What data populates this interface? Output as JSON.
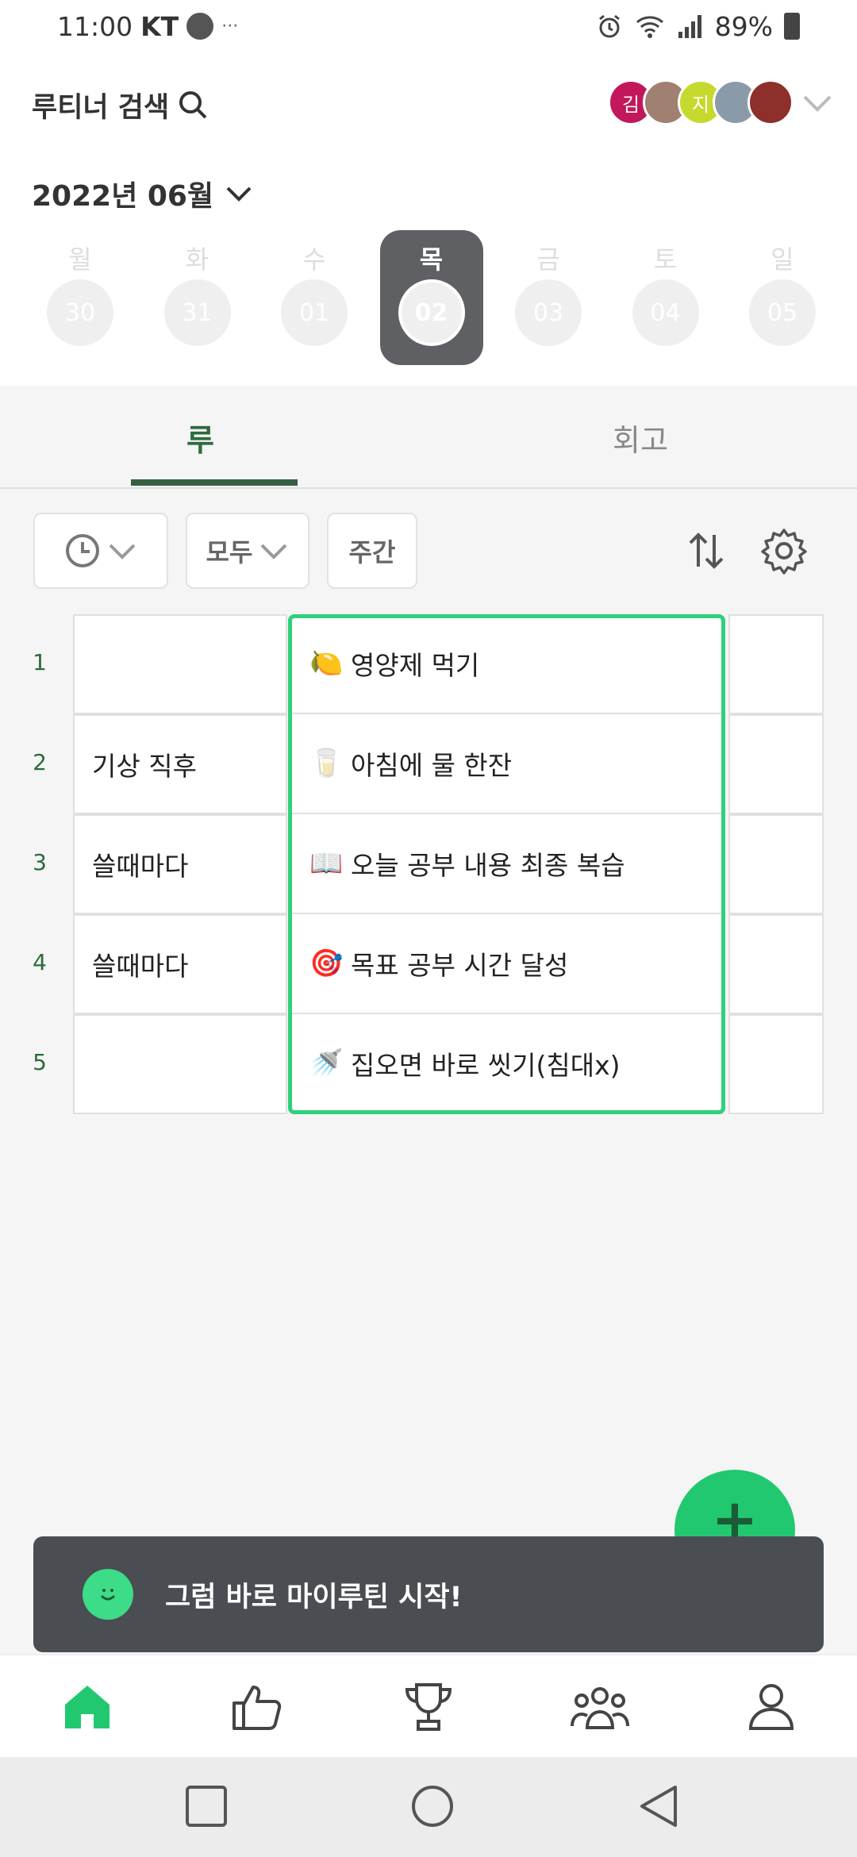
{
  "status_bar": {
    "time": "11:00",
    "carrier": "KT",
    "extra": "···",
    "battery": "89%"
  },
  "header": {
    "search_label": "루티너 검색",
    "avatars": [
      {
        "label": "김",
        "color": "#c2185b"
      },
      {
        "label": "",
        "color": "#a08070"
      },
      {
        "label": "지",
        "color": "#c6d92e"
      },
      {
        "label": "",
        "color": "#8a9aa8"
      },
      {
        "label": "",
        "color": "#8d2f2a"
      }
    ],
    "month": "2022년 06월"
  },
  "week": {
    "days": [
      {
        "dow": "월",
        "num": "30",
        "selected": false
      },
      {
        "dow": "화",
        "num": "31",
        "selected": false
      },
      {
        "dow": "수",
        "num": "01",
        "selected": false
      },
      {
        "dow": "목",
        "num": "02",
        "selected": true
      },
      {
        "dow": "금",
        "num": "03",
        "selected": false
      },
      {
        "dow": "토",
        "num": "04",
        "selected": false
      },
      {
        "dow": "일",
        "num": "05",
        "selected": false
      }
    ]
  },
  "tabs": [
    {
      "label": "루",
      "active": true
    },
    {
      "label": "회고",
      "active": false
    }
  ],
  "filters": {
    "time_icon": "clock-icon",
    "all_label": "모두",
    "weekly_label": "주간"
  },
  "routines": [
    {
      "num": "1",
      "when": "",
      "emoji": "🍋",
      "task": "영양제 먹기"
    },
    {
      "num": "2",
      "when": "기상 직후",
      "emoji": "🥛",
      "task": "아침에 물 한잔"
    },
    {
      "num": "3",
      "when": "쓸때마다",
      "emoji": "📖",
      "task": "오늘 공부 내용 최종 복습"
    },
    {
      "num": "4",
      "when": "쓸때마다",
      "emoji": "🎯",
      "task": "목표 공부 시간 달성"
    },
    {
      "num": "5",
      "when": "",
      "emoji": "🚿",
      "task": "집오면 바로 씻기(침대x)"
    }
  ],
  "fab": {
    "label": "+"
  },
  "toast": {
    "text": "그럼 바로 마이루틴 시작!"
  },
  "colors": {
    "accent": "#22c86f",
    "highlight": "#2fd07c",
    "tab_active": "#2d6a3e",
    "dark": "#4a4d51"
  }
}
